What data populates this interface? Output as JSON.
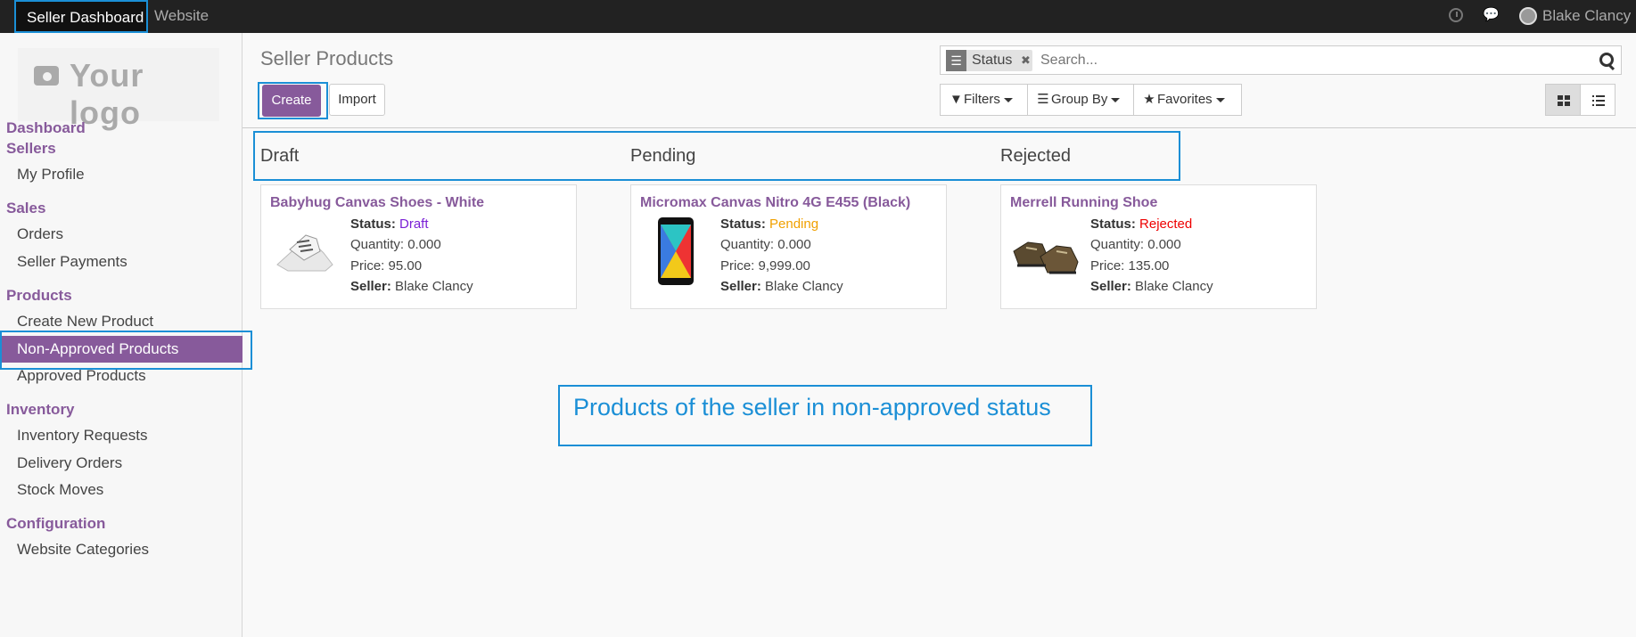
{
  "topbar": {
    "app_menu": [
      "Seller Dashboard",
      "Website"
    ],
    "user": "Blake Clancy"
  },
  "sidebar": {
    "logo_text": "Your logo",
    "sections": [
      {
        "heading": "Dashboard"
      },
      {
        "heading": "Sellers",
        "items": [
          "My Profile"
        ]
      },
      {
        "heading": "Sales",
        "items": [
          "Orders",
          "Seller Payments"
        ]
      },
      {
        "heading": "Products",
        "items": [
          "Create New Product",
          "Non-Approved Products",
          "Approved Products"
        ]
      },
      {
        "heading": "Inventory",
        "items": [
          "Inventory Requests",
          "Delivery Orders",
          "Stock Moves"
        ]
      },
      {
        "heading": "Configuration",
        "items": [
          "Website Categories"
        ]
      }
    ],
    "active_item": "Non-Approved Products"
  },
  "control_panel": {
    "title": "Seller Products",
    "create_label": "Create",
    "import_label": "Import",
    "search": {
      "facet": "Status",
      "placeholder": "Search..."
    },
    "filters_label": "Filters",
    "groupby_label": "Group By",
    "favorites_label": "Favorites"
  },
  "kanban": {
    "columns": [
      {
        "title": "Draft",
        "card": {
          "name": "Babyhug Canvas Shoes - White",
          "status_label": "Status:",
          "status": "Draft",
          "quantity": "Quantity: 0.000",
          "price": "Price: 95.00",
          "seller_label": "Seller:",
          "seller": "Blake Clancy"
        }
      },
      {
        "title": "Pending",
        "card": {
          "name": "Micromax Canvas Nitro 4G E455 (Black)",
          "status_label": "Status:",
          "status": "Pending",
          "quantity": "Quantity: 0.000",
          "price": "Price: 9,999.00",
          "seller_label": "Seller:",
          "seller": "Blake Clancy"
        }
      },
      {
        "title": "Rejected",
        "card": {
          "name": "Merrell Running Shoe",
          "status_label": "Status:",
          "status": "Rejected",
          "quantity": "Quantity: 0.000",
          "price": "Price: 135.00",
          "seller_label": "Seller:",
          "seller": "Blake Clancy"
        }
      }
    ]
  },
  "annotation": "Products of the seller in non-approved status",
  "colors": {
    "accent": "#875a9b",
    "annotation": "#1b8fd6",
    "draft": "#7a1fd6",
    "pending": "#f0a000",
    "rejected": "#e00000"
  }
}
